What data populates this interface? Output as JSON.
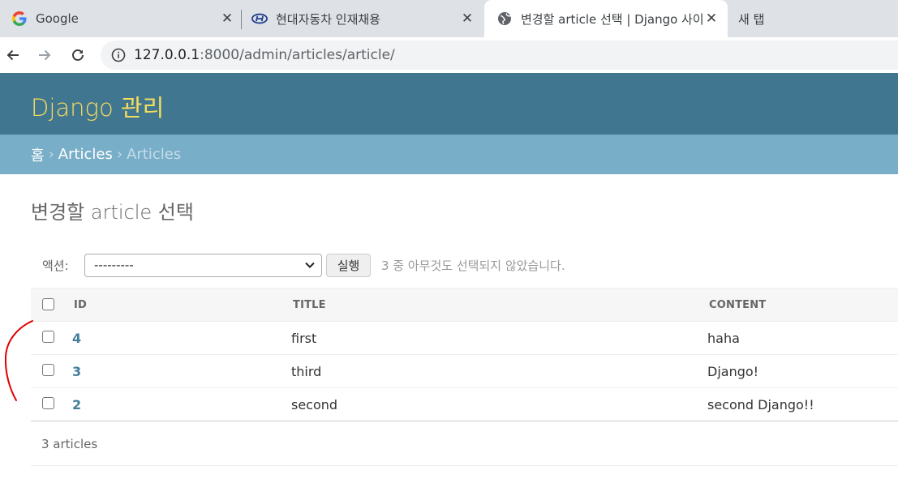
{
  "browser": {
    "tabs": [
      {
        "title": "Google",
        "favicon": "google-g-icon"
      },
      {
        "title": "현대자동차 인재채용",
        "favicon": "hyundai-logo-icon"
      },
      {
        "title": "변경할 article 선택 | Django 사이",
        "favicon": "globe-icon"
      },
      {
        "title": "새 탭"
      }
    ],
    "url_host": "127.0.0.1",
    "url_path": ":8000/admin/articles/article/"
  },
  "admin": {
    "brand": "Django 관리",
    "breadcrumbs": {
      "home": "홈",
      "app": "Articles",
      "model": "Articles",
      "separator": "›"
    },
    "page_title": "변경할 article 선택",
    "actions": {
      "label": "액션:",
      "selected": "---------",
      "go": "실행",
      "counter": "3 중 아무것도 선택되지 않았습니다."
    },
    "columns": {
      "id": "ID",
      "title": "TITLE",
      "content": "CONTENT"
    },
    "rows": [
      {
        "id": "4",
        "title": "first",
        "content": "haha"
      },
      {
        "id": "3",
        "title": "third",
        "content": "Django!"
      },
      {
        "id": "2",
        "title": "second",
        "content": "second Django!!"
      }
    ],
    "paginator": "3 articles"
  },
  "colors": {
    "header": "#417690",
    "brand_text": "#f5dd5d",
    "breadcrumbs": "#79aec8",
    "link": "#447e9b",
    "annotation": "#e00000"
  }
}
